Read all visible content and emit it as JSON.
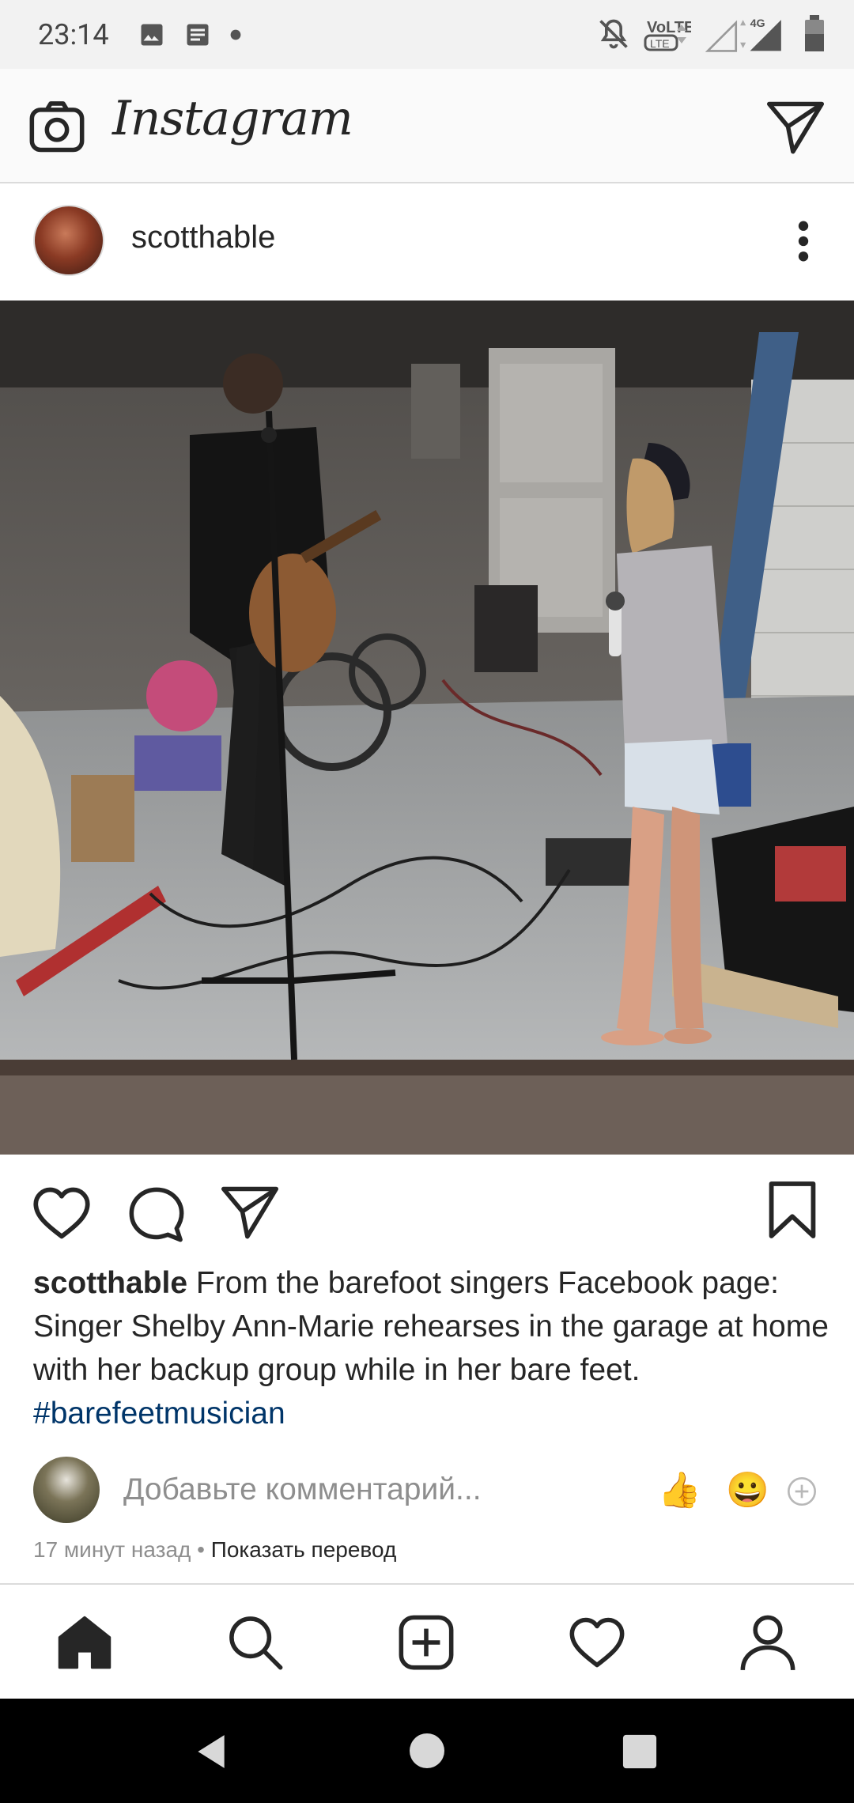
{
  "status_bar": {
    "time": "23:14"
  },
  "header": {
    "logo": "Instagram"
  },
  "post": {
    "username": "scotthable",
    "caption_user": "scotthable",
    "caption_text": "From the barefoot singers Facebook page: Singer Shelby Ann-Marie rehearses in the garage at home with her backup group while in her bare feet.",
    "hashtag": "#barefeetmusician"
  },
  "comment": {
    "placeholder": "Добавьте комментарий...",
    "emoji_1": "👍",
    "emoji_2": "😀"
  },
  "meta": {
    "time_ago": "17 минут назад",
    "separator": "•",
    "translate": "Показать перевод"
  },
  "icons": {
    "status": [
      "image-icon",
      "message-icon",
      "dot-icon",
      "mute-icon",
      "volte-icon",
      "signal-icon",
      "battery-icon"
    ],
    "header": [
      "camera-icon",
      "direct-icon"
    ],
    "actions": [
      "heart-icon",
      "comment-icon",
      "share-icon",
      "bookmark-icon"
    ],
    "nav": [
      "home-icon",
      "search-icon",
      "add-icon",
      "activity-icon",
      "profile-icon"
    ]
  }
}
